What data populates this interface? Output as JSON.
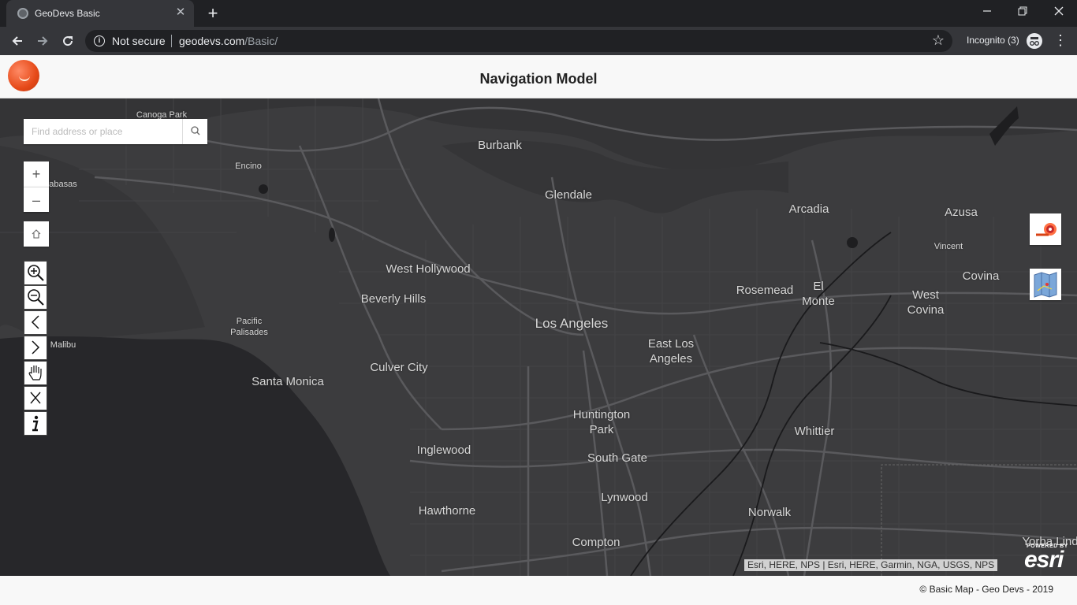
{
  "browser": {
    "tab_title": "GeoDevs Basic",
    "tab_close": "✕",
    "new_tab": "+",
    "security_label": "Not secure",
    "url_host": "geodevs.com",
    "url_path": "/Basic/",
    "incognito_label": "Incognito (3)"
  },
  "app": {
    "title": "Navigation Model"
  },
  "search": {
    "placeholder": "Find address or place"
  },
  "map": {
    "places": [
      {
        "name": "Canoga Park",
        "size": "small"
      },
      {
        "name": "Burbank",
        "size": "normal"
      },
      {
        "name": "Encino",
        "size": "small"
      },
      {
        "name": "abasas",
        "size": "small"
      },
      {
        "name": "Glendale",
        "size": "normal"
      },
      {
        "name": "Arcadia",
        "size": "normal"
      },
      {
        "name": "Azusa",
        "size": "normal"
      },
      {
        "name": "Vincent",
        "size": "small"
      },
      {
        "name": "Covina",
        "size": "normal"
      },
      {
        "name": "West Hollywood",
        "size": "normal"
      },
      {
        "name": "Rosemead",
        "size": "normal"
      },
      {
        "name": "El\nMonte",
        "size": "normal"
      },
      {
        "name": "West\nCovina",
        "size": "normal"
      },
      {
        "name": "Beverly Hills",
        "size": "normal"
      },
      {
        "name": "Los Angeles",
        "size": "big"
      },
      {
        "name": "Pacific\nPalisades",
        "size": "small"
      },
      {
        "name": "Malibu",
        "size": "small"
      },
      {
        "name": "East Los\nAngeles",
        "size": "normal"
      },
      {
        "name": "Culver City",
        "size": "normal"
      },
      {
        "name": "Santa Monica",
        "size": "normal"
      },
      {
        "name": "Huntington\nPark",
        "size": "normal"
      },
      {
        "name": "Whittier",
        "size": "normal"
      },
      {
        "name": "Inglewood",
        "size": "normal"
      },
      {
        "name": "South Gate",
        "size": "normal"
      },
      {
        "name": "Lynwood",
        "size": "normal"
      },
      {
        "name": "Hawthorne",
        "size": "normal"
      },
      {
        "name": "Norwalk",
        "size": "normal"
      },
      {
        "name": "Compton",
        "size": "normal"
      },
      {
        "name": "Yorba Lind",
        "size": "normal"
      }
    ],
    "attribution": "Esri, HERE, NPS | Esri, HERE, Garmin, NGA, USGS, NPS",
    "powered_by": "POWERED BY",
    "esri_logo": "esri"
  },
  "controls": {
    "zoom_in": "+",
    "zoom_out": "–",
    "home": "⌂"
  },
  "footer": {
    "copyright": "© Basic Map - Geo Devs - 2019"
  }
}
